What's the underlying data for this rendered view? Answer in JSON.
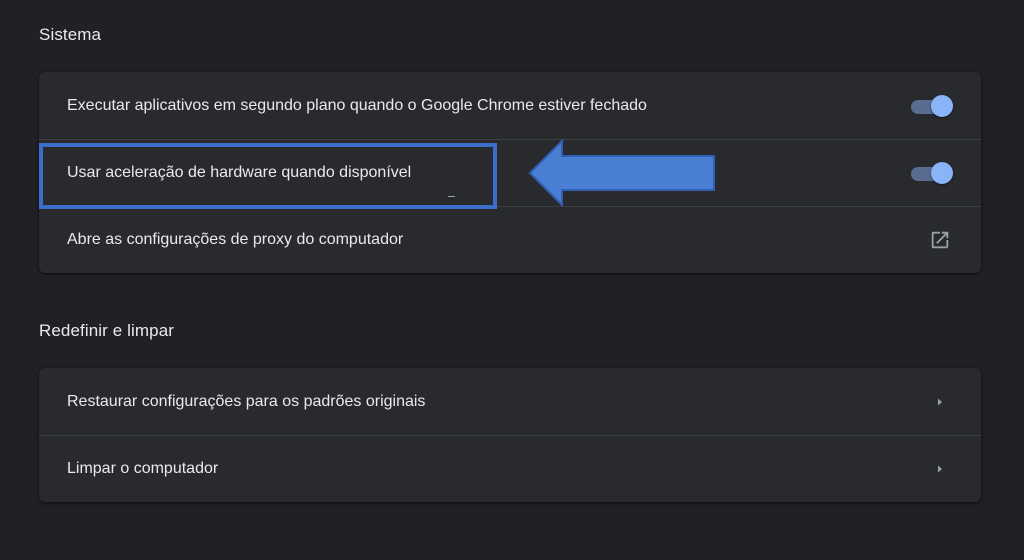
{
  "colors": {
    "background": "#202124",
    "card": "#292a2d",
    "divider": "#3c4043",
    "toggle_track": "#5a6c92",
    "toggle_knob": "#8ab4f8",
    "annotation_blue": "#3b6ec8"
  },
  "sistema": {
    "title": "Sistema",
    "rows": [
      {
        "label": "Executar aplicativos em segundo plano quando o Google Chrome estiver fechado",
        "control": "toggle",
        "checked": true
      },
      {
        "label": "Usar aceleração de hardware quando disponível",
        "control": "toggle",
        "checked": true,
        "highlighted": true
      },
      {
        "label": "Abre as configurações de proxy do computador",
        "control": "external-link-icon"
      }
    ]
  },
  "redefinir": {
    "title": "Redefinir e limpar",
    "rows": [
      {
        "label": "Restaurar configurações para os padrões originais",
        "control": "chevron-right-icon"
      },
      {
        "label": "Limpar o computador",
        "control": "chevron-right-icon"
      }
    ]
  },
  "annotation": {
    "type": "arrow-pointing-left",
    "target": "sistema.rows.1"
  }
}
